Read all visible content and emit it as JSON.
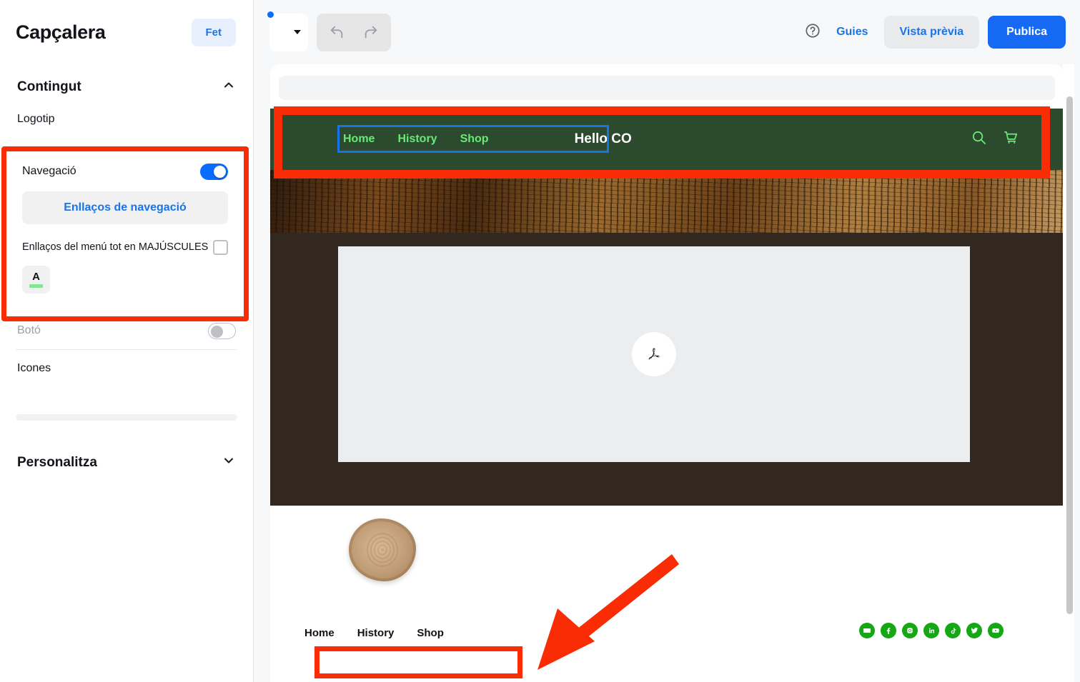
{
  "sidebar": {
    "title": "Capçalera",
    "done_label": "Fet",
    "sections": [
      {
        "title": "Contingut",
        "chevron": "chevron-up-icon"
      },
      {
        "title": "Personalitza",
        "chevron": "chevron-down-icon"
      }
    ],
    "logotip_label": "Logotip",
    "navigation": {
      "label": "Navegació",
      "toggle_state": "on",
      "nav_links_button": "Enllaços de navegació",
      "caps_label": "Enllaços del menú tot en MAJÚSCULES",
      "caps_checked": false,
      "font_swatch_letter": "A",
      "font_swatch_color": "#7ee895"
    },
    "button_row": {
      "label": "Botó",
      "toggle_state": "off"
    },
    "icons_row": {
      "label": "Icones"
    }
  },
  "toolbar": {
    "device_icon": "monitor-icon",
    "device_caret": "caret-down-icon",
    "undo_icon": "undo-icon",
    "redo_icon": "redo-icon",
    "help_icon": "help-circle-icon",
    "guides_label": "Guies",
    "preview_label": "Vista prèvia",
    "publish_label": "Publica"
  },
  "preview": {
    "site_header": {
      "nav_links": [
        "Home",
        "History",
        "Shop"
      ],
      "brand": "Hello CO",
      "icons": [
        "search-icon",
        "cart-icon"
      ],
      "bg_color": "#2c4a2d",
      "link_color": "#6ae878",
      "selection_border_color": "#1673ea"
    },
    "body": {
      "pdf_icon": "adobe-pdf-icon",
      "content_bg": "#332820"
    },
    "footer": {
      "nav_links": [
        "Home",
        "History",
        "Shop"
      ],
      "social_icons": [
        "email-icon",
        "facebook-icon",
        "instagram-icon",
        "linkedin-icon",
        "tiktok-icon",
        "twitter-icon",
        "youtube-icon"
      ],
      "social_color": "#15a814"
    }
  },
  "annotations": {
    "highlight_color": "#fa2c06",
    "boxes": [
      "navigation-panel",
      "site-header",
      "footer-nav"
    ],
    "arrow": "arrow-pointing-to-footer-nav"
  }
}
